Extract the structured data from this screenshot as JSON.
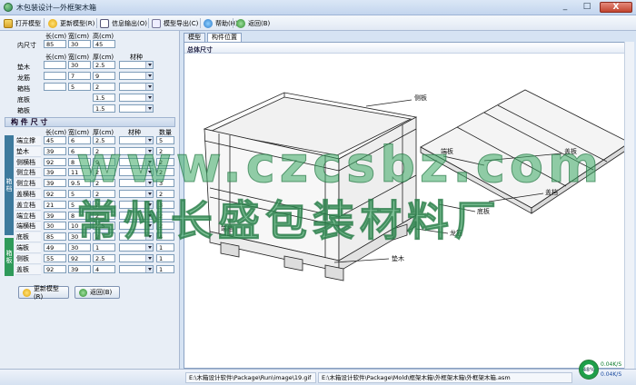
{
  "window": {
    "title": "木包装设计—外框架木箱",
    "min": "_",
    "max": "□",
    "close": "X"
  },
  "toolbar": {
    "open_model": "打开模型",
    "update_model": "更新模型(R)",
    "info_export": "信息输出(O)",
    "model_export": "模型导出(C)",
    "help": "帮助(H)",
    "back": "返回(B)"
  },
  "inner_size": {
    "label": "内尺寸",
    "headers": [
      "长(cm)",
      "宽(cm)",
      "高(cm)"
    ],
    "values": [
      "85",
      "30",
      "45"
    ]
  },
  "materials": {
    "headers": [
      "长(cm)",
      "宽(cm)",
      "厚(cm)",
      "材种"
    ],
    "rows": [
      {
        "label": "垫木",
        "l": "",
        "w": "30",
        "t": "2.5"
      },
      {
        "label": "龙筋",
        "l": "",
        "w": "7",
        "t": "9"
      },
      {
        "label": "箱档",
        "l": "",
        "w": "5",
        "t": "2"
      },
      {
        "label": "底板",
        "l": "",
        "w": "",
        "t": "1.5"
      },
      {
        "label": "箱板",
        "l": "",
        "w": "",
        "t": "1.5"
      }
    ]
  },
  "parts": {
    "title": "构 件 尺 寸",
    "headers": [
      "长(cm)",
      "宽(cm)",
      "厚(cm)",
      "材种",
      "数量"
    ],
    "group_box": "箱档",
    "group_bottom": "箱板",
    "rows": [
      {
        "label": "端立撑",
        "l": "45",
        "w": "6",
        "t": "2.5",
        "q": "5"
      },
      {
        "label": "垫木",
        "l": "39",
        "w": "6",
        "t": "2",
        "q": "2"
      },
      {
        "label": "侧横档",
        "l": "92",
        "w": "8",
        "t": "9",
        "q": "2"
      },
      {
        "label": "侧立档",
        "l": "39",
        "w": "11",
        "t": "2",
        "q": "2"
      },
      {
        "label": "侧立档",
        "l": "39",
        "w": "9.5",
        "t": "2",
        "q": "3"
      },
      {
        "label": "盖横档",
        "l": "92",
        "w": "5",
        "t": "2",
        "q": "2"
      },
      {
        "label": "盖立档",
        "l": "21",
        "w": "5",
        "t": "2",
        "q": "3"
      },
      {
        "label": "端立档",
        "l": "39",
        "w": "8",
        "t": "2",
        "q": "2"
      },
      {
        "label": "端横档",
        "l": "30",
        "w": "10",
        "t": "2.5",
        "q": "2"
      },
      {
        "label": "底板",
        "l": "85",
        "w": "30",
        "t": "2",
        "q": "4"
      },
      {
        "label": "端板",
        "l": "49",
        "w": "30",
        "t": "1",
        "q": "1"
      },
      {
        "label": "侧板",
        "l": "55",
        "w": "92",
        "t": "2.5",
        "q": "1"
      },
      {
        "label": "盖板",
        "l": "92",
        "w": "39",
        "t": "4",
        "q": "1"
      }
    ]
  },
  "buttons": {
    "update": "更新模型(R)",
    "back": "返回(B)"
  },
  "tabs": [
    "模型",
    "构件位置"
  ],
  "canvas": {
    "caption": "总体尺寸",
    "labels": [
      "侧板",
      "盖板",
      "端板",
      "盖档",
      "底板",
      "端档",
      "龙筋",
      "垫木"
    ]
  },
  "watermark": {
    "url": "www.czcsbz.com",
    "company": "常州长盛包装材料厂"
  },
  "status": {
    "path1": "E:\\木箱设计软件\\Package\\Run\\image\\19.gif",
    "path2": "E:\\木箱设计软件\\Package\\Mold\\框架木箱\\外框架木箱\\外框架木箱.asm",
    "cpu": "48%",
    "up": "0.04K/S",
    "down": "0.04K/S"
  }
}
